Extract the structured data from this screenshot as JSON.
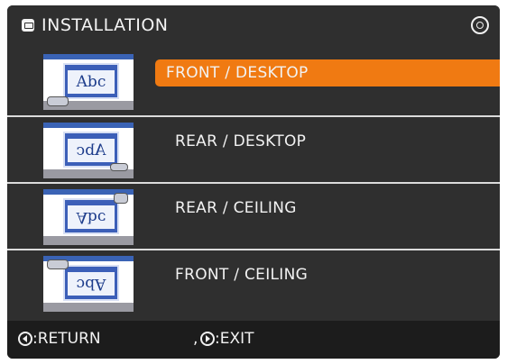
{
  "window": {
    "title": "INSTALLATION",
    "title_icon": "menu-icon",
    "nav_icon": "nav-cross-icon"
  },
  "options": [
    {
      "label": "FRONT / DESKTOP",
      "thumb_text": "Abc",
      "selected": true
    },
    {
      "label": "REAR / DESKTOP",
      "thumb_text": "Abc",
      "selected": false
    },
    {
      "label": "REAR / CEILING",
      "thumb_text": "Abc",
      "selected": false
    },
    {
      "label": "FRONT / CEILING",
      "thumb_text": "Abc",
      "selected": false
    }
  ],
  "footer": {
    "return_label": ":RETURN",
    "separator": ",",
    "exit_label": ":EXIT"
  },
  "colors": {
    "background": "#2f2f2f",
    "highlight": "#f07a12",
    "footer": "#1c1c1c",
    "text": "#f2f2f2"
  }
}
